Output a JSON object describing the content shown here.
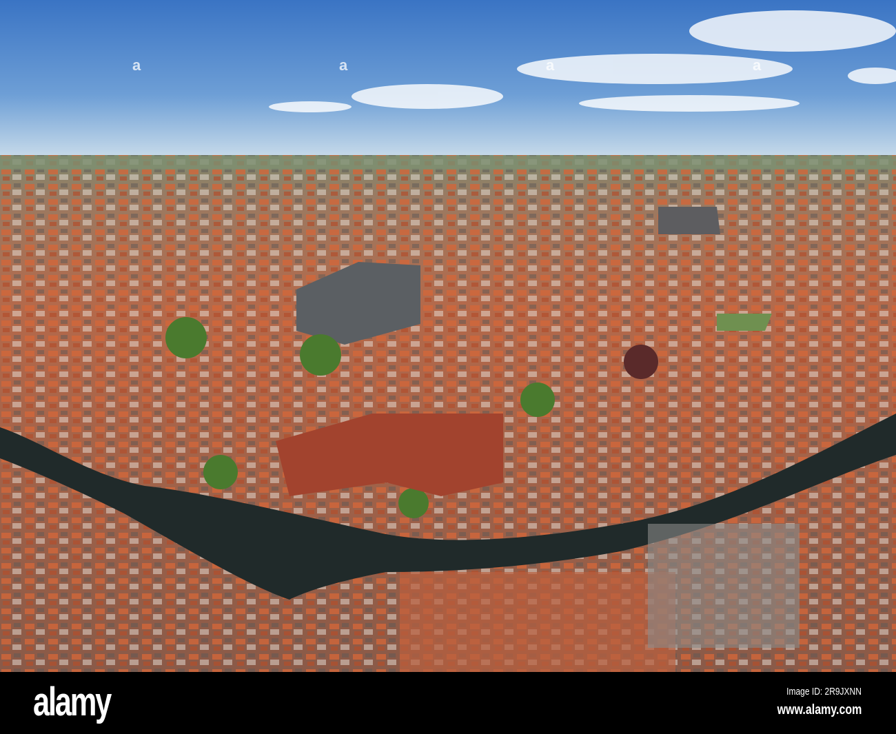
{
  "watermark": {
    "logo": "alamy",
    "image_id_label": "Image ID: 2R9JXNN",
    "website": "www.alamy.com"
  },
  "colors": {
    "sky_top": "#3b78c8",
    "sky_horizon": "#c9dcea",
    "roof": "#c8643a",
    "canal": "#1f2a2a",
    "bar": "#000000"
  }
}
